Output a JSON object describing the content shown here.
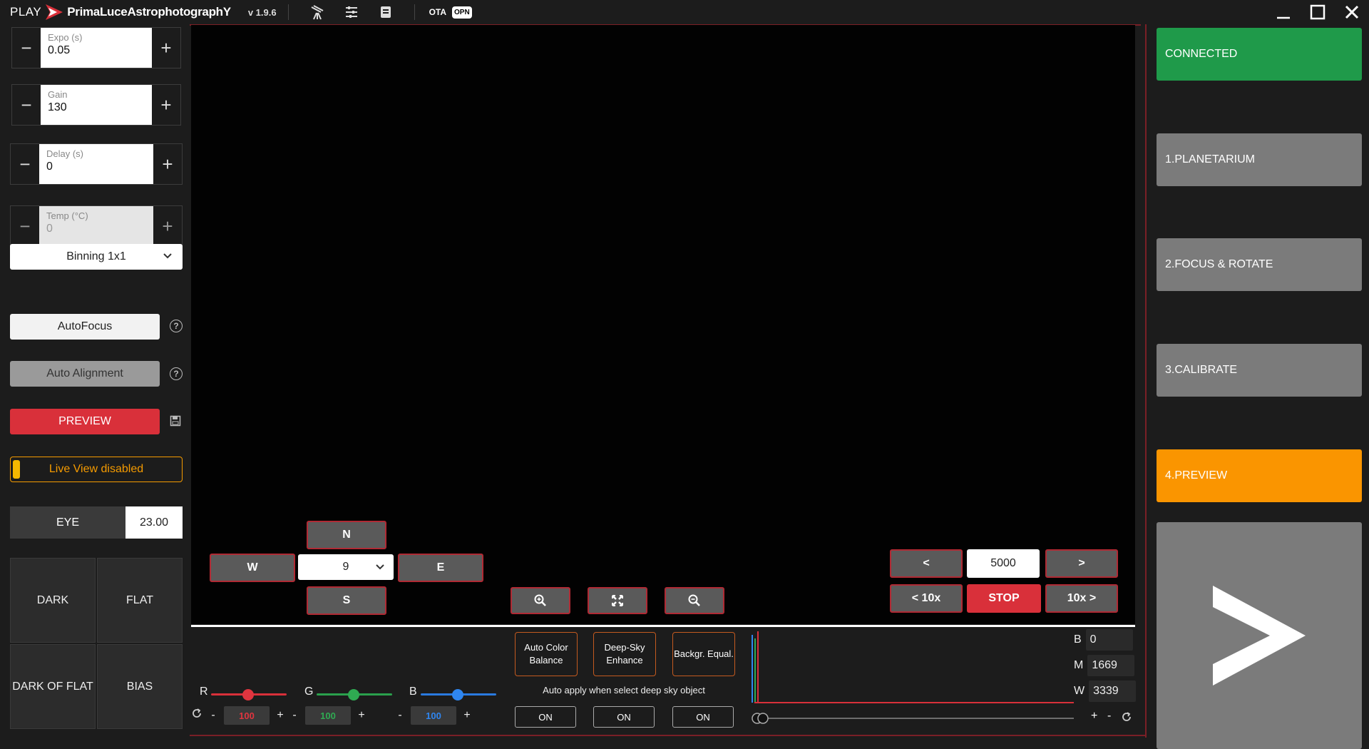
{
  "titlebar": {
    "play": "PLAY",
    "app_name": "PrimaLuceAstrophotographY",
    "version": "v 1.9.6",
    "ota": "OTA",
    "opn": "OPN"
  },
  "camera": {
    "expo": {
      "label": "Expo (s)",
      "value": "0.05"
    },
    "gain": {
      "label": "Gain",
      "value": "130"
    },
    "delay": {
      "label": "Delay (s)",
      "value": "0"
    },
    "temp": {
      "label": "Temp (°C)",
      "value": "0"
    },
    "binning": "Binning 1x1",
    "autofocus": "AutoFocus",
    "auto_alignment": "Auto Alignment",
    "preview": "PREVIEW",
    "live_view": "Live View disabled",
    "eye_label": "EYE",
    "eye_value": "23.00",
    "calibration": {
      "dark": "DARK",
      "flat": "FLAT",
      "dark_of_flat": "DARK OF FLAT",
      "bias": "BIAS"
    }
  },
  "mount": {
    "north": "N",
    "south": "S",
    "west": "W",
    "east": "E",
    "speed": "9"
  },
  "focuser": {
    "prev": "<",
    "next": ">",
    "prev10": "< 10x",
    "next10": "10x >",
    "steps": "5000",
    "stop": "STOP"
  },
  "processing": {
    "r_label": "R",
    "g_label": "G",
    "b_label": "B",
    "r_value": "100",
    "g_value": "100",
    "b_value": "100",
    "auto_color": "Auto Color Balance",
    "deep_sky": "Deep-Sky Enhance",
    "backgr": "Backgr. Equal.",
    "auto_apply": "Auto apply when select deep sky object",
    "on1": "ON",
    "on2": "ON",
    "on3": "ON"
  },
  "histogram": {
    "b_label": "B",
    "b_value": "0",
    "m_label": "M",
    "m_value": "1669",
    "w_label": "W",
    "w_value": "3339",
    "plus": "+",
    "minus": "-"
  },
  "steps": {
    "connected": "CONNECTED",
    "planetarium": "1.PLANETARIUM",
    "focus_rotate": "2.FOCUS & ROTATE",
    "calibrate": "3.CALIBRATE",
    "preview": "4.PREVIEW"
  },
  "colors": {
    "accent_red": "#d9303a",
    "connected_green": "#1f9a4a",
    "active_orange": "#fa9500",
    "inactive_gray": "#7b7b7b"
  }
}
